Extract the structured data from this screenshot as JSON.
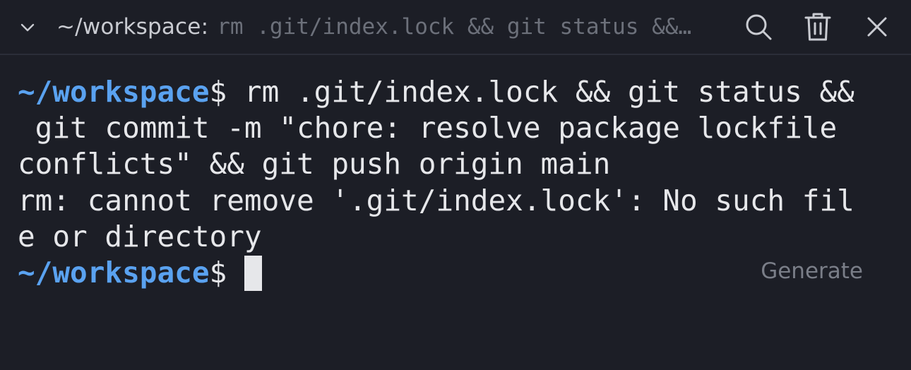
{
  "header": {
    "cwd": "~/workspace:",
    "command_preview": "rm .git/index.lock && git status && git commit -m \"chore: resolve package lockfile conflicts\" && git push origin main",
    "icons": {
      "collapse": "chevron-down-icon",
      "search": "search-icon",
      "trash": "trash-icon",
      "close": "close-icon"
    }
  },
  "terminal": {
    "prompt_path": "~/workspace",
    "prompt_symbol": "$ ",
    "command_lines": [
      "rm .git/index.lock && git status &&",
      " git commit -m \"chore: resolve package lockfile",
      "conflicts\" && git push origin main"
    ],
    "output_lines": [
      "rm: cannot remove '.git/index.lock': No such fil",
      "e or directory"
    ],
    "current_prompt_path": "~/workspace",
    "current_prompt_symbol": "$ "
  },
  "generate_label": "Generate",
  "colors": {
    "background": "#1c1e26",
    "prompt_path": "#5aa2f0",
    "text": "#e6e7ea",
    "muted": "#7a7e88"
  }
}
